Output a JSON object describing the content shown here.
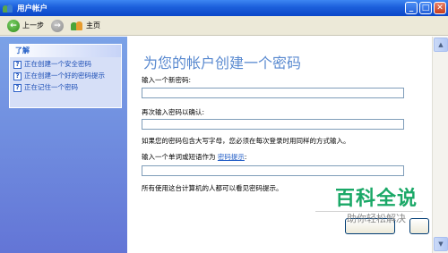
{
  "window": {
    "title": "用户帐户",
    "controls": {
      "minimize": "_",
      "maximize": "□",
      "close": "✕"
    }
  },
  "toolbar": {
    "back_label": "上一步",
    "back_symbol": "←",
    "forward_symbol": "→",
    "home_label": "主页"
  },
  "sidebar": {
    "section_title": "了解",
    "items": [
      {
        "label": "正在创建一个安全密码",
        "icon": "help-icon",
        "icon_symbol": "?"
      },
      {
        "label": "正在创建一个好的密码提示",
        "icon": "help-icon",
        "icon_symbol": "?"
      },
      {
        "label": "正在记住一个密码",
        "icon": "help-icon",
        "icon_symbol": "?"
      }
    ]
  },
  "main": {
    "title": "为您的帐户创建一个密码",
    "new_password_label": "输入一个新密码:",
    "new_password_value": "",
    "confirm_password_label": "再次输入密码以确认:",
    "confirm_password_value": "",
    "case_note": "如果您的密码包含大写字母，您必须在每次登录时用同样的方式输入。",
    "hint_label_prefix": "输入一个单词或短语作为",
    "hint_link": "密码提示",
    "hint_label_suffix": ":",
    "hint_value": "",
    "visibility_note": "所有使用这台计算机的人都可以看见密码提示。"
  },
  "watermark": {
    "main": "百科全说",
    "sub": "助你轻松解决"
  },
  "scrollbar": {
    "up_symbol": "▲",
    "down_symbol": "▼"
  },
  "colors": {
    "titlebar": "#0a46c8",
    "sidebar": "#6375d6",
    "heading": "#5a8ad0",
    "link": "#215dc6",
    "watermark": "#1aa867"
  }
}
